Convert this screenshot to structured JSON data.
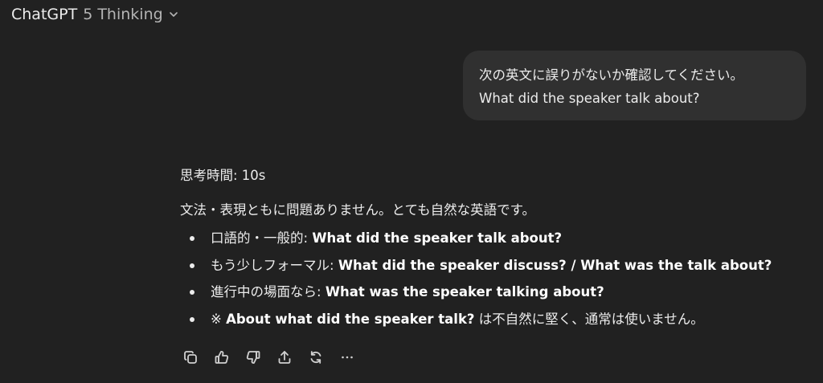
{
  "header": {
    "brand": "ChatGPT",
    "model": "5 Thinking",
    "dropdown_icon": "chevron-down-icon"
  },
  "user_message": {
    "line1": "次の英文に誤りがないか確認してください。",
    "line2": "What did the speaker talk about?"
  },
  "assistant_message": {
    "thinking_label": "思考時間: 10s",
    "intro": "文法・表現ともに問題ありません。とても自然な英語です。",
    "points": [
      {
        "prefix": "口語的・一般的: ",
        "bold": "What did the speaker talk about?",
        "suffix": ""
      },
      {
        "prefix": "もう少しフォーマル: ",
        "bold": "What did the speaker discuss? / What was the talk about?",
        "suffix": ""
      },
      {
        "prefix": "進行中の場面なら: ",
        "bold": "What was the speaker talking about?",
        "suffix": ""
      },
      {
        "prefix": "※ ",
        "bold": "About what did the speaker talk?",
        "suffix": " は不自然に堅く、通常は使いません。"
      }
    ]
  },
  "actions": [
    {
      "name": "copy-icon"
    },
    {
      "name": "thumbs-up-icon"
    },
    {
      "name": "thumbs-down-icon"
    },
    {
      "name": "share-icon"
    },
    {
      "name": "regenerate-icon"
    },
    {
      "name": "more-icon"
    }
  ],
  "colors": {
    "background": "#212121",
    "bubble": "#303030",
    "text": "#ececec",
    "muted": "#b4b4b4"
  }
}
